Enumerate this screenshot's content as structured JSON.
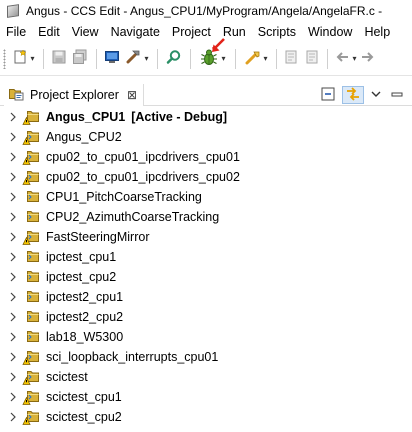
{
  "window": {
    "title": "Angus - CCS Edit - Angus_CPU1/MyProgram/Angela/AngelaFR.c -"
  },
  "menu": {
    "items": [
      "File",
      "Edit",
      "View",
      "Navigate",
      "Project",
      "Run",
      "Scripts",
      "Window",
      "Help"
    ],
    "mnemonic_color": "#000000"
  },
  "toolbar": {
    "icons": [
      "new-icon",
      "save-icon",
      "save-all-icon",
      "terminal-icon",
      "build-icon",
      "search-icon",
      "debug-icon",
      "flash-icon",
      "format-icon",
      "back-icon",
      "forward-icon"
    ],
    "highlight_arrow_color": "#e2231a"
  },
  "explorer": {
    "tab_label": "Project Explorer",
    "close_glyph": "⊠",
    "folder_color": "#d9b23a",
    "selected": {
      "label": "Angus_CPU1",
      "status": "[Active - Debug]"
    },
    "projects": [
      {
        "label": "Angus_CPU2",
        "icon": "ccs-project-icon",
        "warn": true
      },
      {
        "label": "cpu02_to_cpu01_ipcdrivers_cpu01",
        "icon": "ccs-project-icon",
        "warn": true
      },
      {
        "label": "cpu02_to_cpu01_ipcdrivers_cpu02",
        "icon": "ccs-project-icon",
        "warn": true
      },
      {
        "label": "CPU1_PitchCoarseTracking",
        "icon": "ccs-project-icon",
        "warn": false
      },
      {
        "label": "CPU2_AzimuthCoarseTracking",
        "icon": "ccs-project-icon",
        "warn": false
      },
      {
        "label": "FastSteeringMirror",
        "icon": "ccs-project-icon",
        "warn": true
      },
      {
        "label": "ipctest_cpu1",
        "icon": "ccs-project-icon",
        "warn": false
      },
      {
        "label": "ipctest_cpu2",
        "icon": "ccs-project-icon",
        "warn": false
      },
      {
        "label": "ipctest2_cpu1",
        "icon": "ccs-project-icon",
        "warn": false
      },
      {
        "label": "ipctest2_cpu2",
        "icon": "ccs-project-icon",
        "warn": false
      },
      {
        "label": "lab18_W5300",
        "icon": "ccs-project-icon",
        "warn": false
      },
      {
        "label": "sci_loopback_interrupts_cpu01",
        "icon": "ccs-project-icon",
        "warn": true
      },
      {
        "label": "scictest",
        "icon": "ccs-project-icon",
        "warn": true
      },
      {
        "label": "scictest_cpu1",
        "icon": "ccs-project-icon",
        "warn": true
      },
      {
        "label": "scictest_cpu2",
        "icon": "ccs-project-icon",
        "warn": true
      }
    ]
  }
}
